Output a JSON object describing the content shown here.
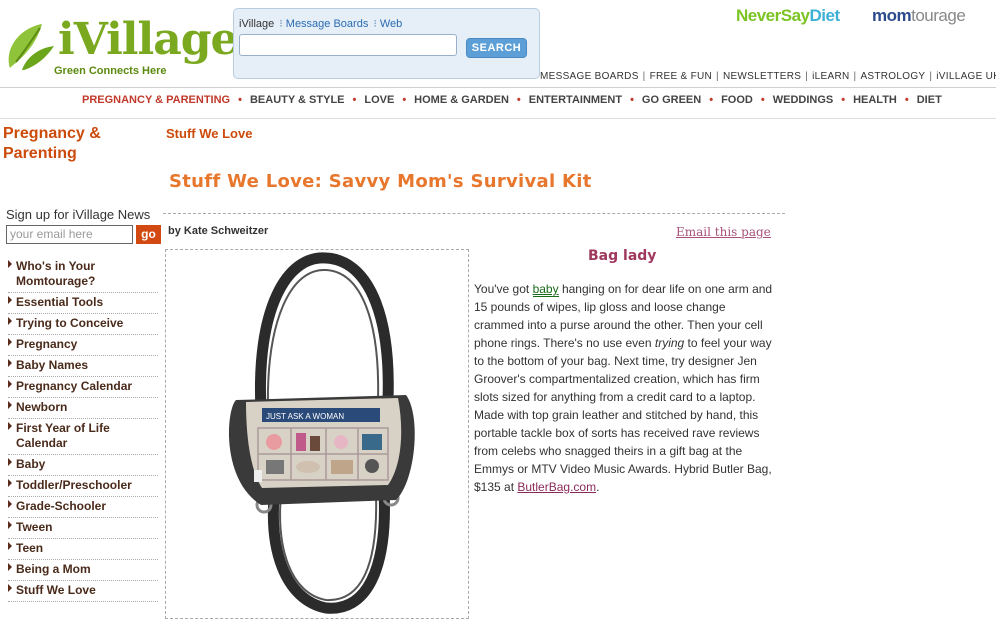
{
  "logo": {
    "word": "iVillage",
    "tagline": "Green Connects Here"
  },
  "search": {
    "tabs": [
      "iVillage",
      "Message Boards",
      "Web"
    ],
    "button": "SEARCH",
    "value": ""
  },
  "brands": {
    "nsd_a": "NeverSay",
    "nsd_b": "Diet",
    "mom_a": "mom",
    "mom_b": "tourage"
  },
  "util_nav": [
    "MESSAGE BOARDS",
    "FREE & FUN",
    "NEWSLETTERS",
    "iLEARN",
    "ASTROLOGY",
    "iVILLAGE UK"
  ],
  "main_nav": [
    "PREGNANCY & PARENTING",
    "BEAUTY & STYLE",
    "LOVE",
    "HOME & GARDEN",
    "ENTERTAINMENT",
    "GO GREEN",
    "FOOD",
    "WEDDINGS",
    "HEALTH",
    "DIET"
  ],
  "sidebar": {
    "title": "Pregnancy & Parenting",
    "signup": "Sign up for iVillage News",
    "email_placeholder": "your email here",
    "go": "go",
    "items": [
      "Who's in Your Momtourage?",
      "Essential Tools",
      "Trying to Conceive",
      "Pregnancy",
      "Baby Names",
      "Pregnancy Calendar",
      "Newborn",
      "First Year of Life Calendar",
      "Baby",
      "Toddler/Preschooler",
      "Grade-Schooler",
      "Tween",
      "Teen",
      "Being a Mom",
      "Stuff We Love"
    ]
  },
  "article": {
    "crumb": "Stuff We Love",
    "title": "Stuff We Love: Savvy Mom's Survival Kit",
    "byline": "by Kate Schweitzer",
    "email_page": "Email this page",
    "subtitle": "Bag lady",
    "body_1": "You've got ",
    "body_link_baby": "baby",
    "body_2": " hanging on for dear life on one arm and 15 pounds of wipes, lip gloss and loose change crammed into a purse around the other. Then your cell phone rings. There's no use even ",
    "body_italic": "trying",
    "body_3": " to feel your way to the bottom of your bag. Next time, try designer Jen Groover's compartmentalized creation, which has firm slots sized for anything from a credit card to a laptop. Made with top grain leather and stitched by hand, this portable tackle box of sorts has received rave reviews from celebs who snagged theirs in a gift bag at the Emmys or MTV Video Music Awards. Hybrid Butler Bag, $135 at ",
    "body_link_site": "ButlerBag.com",
    "body_4": ".",
    "book_label": "JUST ASK A WOMAN"
  }
}
